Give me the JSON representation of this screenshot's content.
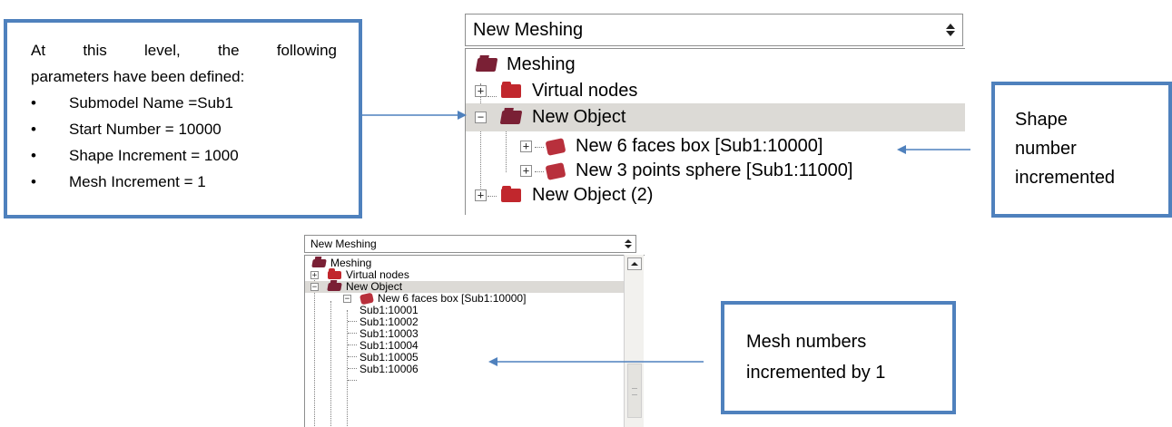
{
  "callouts": {
    "params": {
      "intro_line1": "At this level, the following",
      "intro_line2": "parameters have been defined:",
      "bullets": [
        "Submodel Name =Sub1",
        "Start Number = 10000",
        "Shape Increment = 1000",
        "Mesh Increment = 1"
      ]
    },
    "shape": {
      "line1": "Shape",
      "line2": "number",
      "line3": "incremented"
    },
    "mesh": {
      "line1": "Mesh numbers",
      "line2": "incremented by 1"
    }
  },
  "tree_large": {
    "combo_value": "New Meshing",
    "items": [
      {
        "label": "Meshing",
        "icon": "folder-open-icon"
      },
      {
        "label": "Virtual nodes",
        "icon": "folder-icon",
        "expander": "+"
      },
      {
        "label": "New Object",
        "icon": "folder-open-icon",
        "expander": "−"
      },
      {
        "label": "New 6 faces box [Sub1:10000]",
        "icon": "shape-icon",
        "expander": "+"
      },
      {
        "label": "New 3 points sphere [Sub1:11000]",
        "icon": "shape-icon",
        "expander": "+"
      },
      {
        "label": "New Object (2)",
        "icon": "folder-icon",
        "expander": "+"
      }
    ]
  },
  "tree_small": {
    "combo_value": "New Meshing",
    "items": [
      {
        "label": "Meshing",
        "icon": "folder-open-icon"
      },
      {
        "label": "Virtual nodes",
        "icon": "folder-icon",
        "expander": "+"
      },
      {
        "label": "New Object",
        "icon": "folder-open-icon",
        "expander": "−"
      },
      {
        "label": "New 6 faces box [Sub1:10000]",
        "icon": "shape-icon",
        "expander": "−"
      },
      {
        "label": "Sub1:10001"
      },
      {
        "label": "Sub1:10002"
      },
      {
        "label": "Sub1:10003"
      },
      {
        "label": "Sub1:10004"
      },
      {
        "label": "Sub1:10005"
      },
      {
        "label": "Sub1:10006"
      }
    ]
  },
  "colors": {
    "callout_border": "#4f81bd",
    "arrow": "#4f81bd",
    "selection": "#dcdad6",
    "icon_red": "#c1272d"
  }
}
